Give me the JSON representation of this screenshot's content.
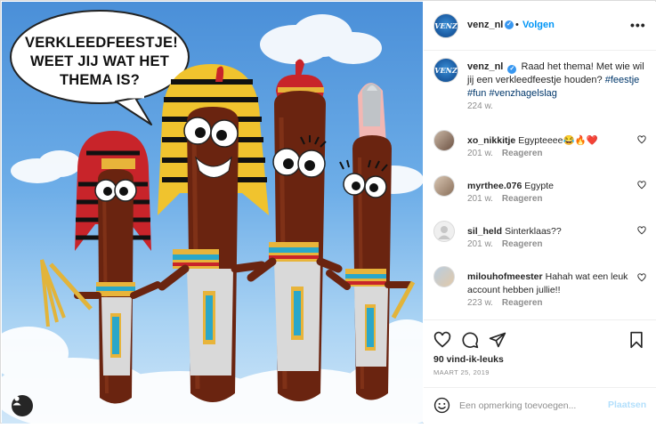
{
  "post_image": {
    "speech_bubble_lines": [
      "VERKLEEDFEESTJE!",
      "WEET JIJ WAT HET",
      "THEMA IS?"
    ],
    "tagged_user_icon": "user-silhouette-icon"
  },
  "header": {
    "username": "venz_nl",
    "avatar_text": "VENZ",
    "separator": "•",
    "follow_label": "Volgen",
    "more_label": "•••"
  },
  "caption": {
    "username": "venz_nl",
    "text": "Raad het thema! Met wie wil jij een verkleedfeestje houden?",
    "hashtags": "#feestje #fun #venzhagelslag",
    "time": "224 w."
  },
  "comments": [
    {
      "username": "xo_nikkitje",
      "text": "Egypteeee😂🔥❤️",
      "time": "201 w.",
      "reply_label": "Reageren"
    },
    {
      "username": "myrthee.076",
      "text": "Egypte",
      "time": "201 w.",
      "reply_label": "Reageren"
    },
    {
      "username": "sil_held",
      "text": "Sinterklaas??",
      "time": "201 w.",
      "reply_label": "Reageren"
    },
    {
      "username": "milouhofmeester",
      "text": "Hahah wat een leuk account hebben jullie!!",
      "time": "223 w.",
      "reply_label": "Reageren"
    }
  ],
  "actions": {
    "likes": "90 vind-ik-leuks",
    "date": "MAART 25, 2019"
  },
  "add_comment": {
    "placeholder": "Een opmerking toevoegen...",
    "post_label": "Plaatsen"
  },
  "colors": {
    "link_blue": "#0095f6",
    "verified_blue": "#3897f0",
    "muted": "#8e8e8e",
    "heart_red": "#ed4956"
  }
}
